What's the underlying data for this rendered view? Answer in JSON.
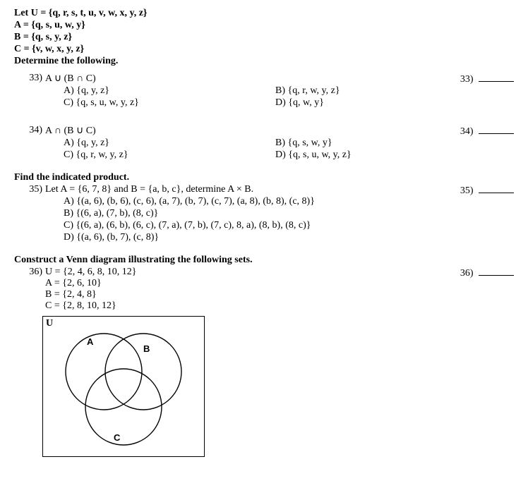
{
  "preamble": {
    "line1": "Let U = {q, r, s, t, u, v, w, x, y, z}",
    "line2": "A = {q, s, u, w, y}",
    "line3": "B = {q, s, y, z}",
    "line4": "C = {v, w, x, y, z}",
    "line5": "Determine the following."
  },
  "q33": {
    "num_label": "33)",
    "text": "A ∪ (B ∩ C)",
    "choiceA": "A) {q, y, z}",
    "choiceB": "B) {q, r, w, y, z}",
    "choiceC": "C) {q, s, u, w, y, z}",
    "choiceD": "D) {q, w, y}",
    "ans_label": "33)"
  },
  "q34": {
    "num_label": "34)",
    "text": "A ∩ (B ∪ C)",
    "choiceA": "A) {q, y, z}",
    "choiceB": "B) {q, s, w, y}",
    "choiceC": "C) {q, r, w, y, z}",
    "choiceD": "D) {q, s, u, w, y, z}",
    "ans_label": "34)"
  },
  "sec35": {
    "heading": "Find the indicated product."
  },
  "q35": {
    "num_label": "35)",
    "text": "Let A = {6, 7, 8} and B = {a, b, c}, determine A × B.",
    "choiceA": "A) {(a, 6), (b, 6), (c, 6), (a, 7), (b, 7), (c, 7), (a, 8), (b, 8), (c, 8)}",
    "choiceB": "B) {(6, a), (7, b), (8, c)}",
    "choiceC": "C) {(6, a), (6, b), (6, c), (7, a), (7, b), (7, c), 8, a), (8, b), (8, c)}",
    "choiceD": "D) {(a, 6), (b, 7), (c, 8)}",
    "ans_label": "35)"
  },
  "sec36": {
    "heading": "Construct a Venn diagram illustrating the following sets."
  },
  "q36": {
    "num_label": "36)",
    "line1": "U = {2, 4, 6, 8, 10, 12}",
    "line2": "A = {2, 6, 10}",
    "line3": "B = {2, 4, 8}",
    "line4": "C = {2, 8, 10, 12}",
    "ans_label": "36)",
    "venn": {
      "U": "U",
      "A": "A",
      "B": "B",
      "C": "C"
    }
  }
}
